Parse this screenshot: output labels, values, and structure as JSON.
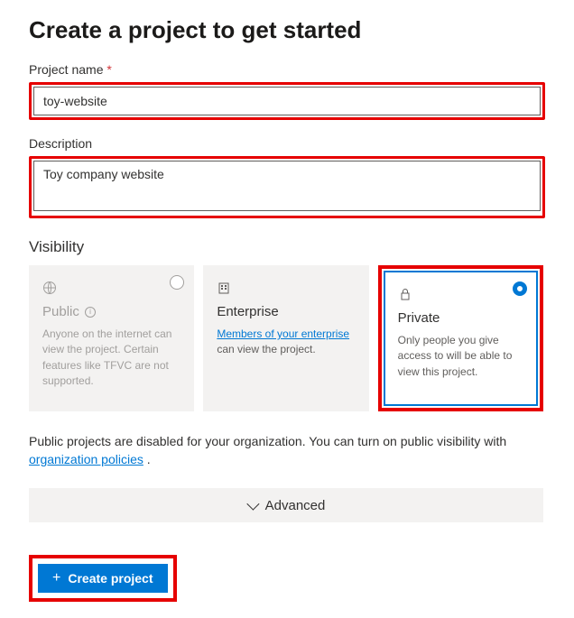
{
  "heading": "Create a project to get started",
  "projectName": {
    "label": "Project name",
    "requiredMark": "*",
    "value": "toy-website"
  },
  "description": {
    "label": "Description",
    "value": "Toy company website"
  },
  "visibility": {
    "label": "Visibility",
    "options": [
      {
        "key": "public",
        "title": "Public",
        "desc": "Anyone on the internet can view the project. Certain features like TFVC are not supported.",
        "disabled": true,
        "selected": false
      },
      {
        "key": "enterprise",
        "title": "Enterprise",
        "descPrefix": "Members of your enterprise",
        "descSuffix": " can view the project.",
        "disabled": false,
        "selected": false
      },
      {
        "key": "private",
        "title": "Private",
        "desc": "Only people you give access to will be able to view this project.",
        "disabled": false,
        "selected": true
      }
    ]
  },
  "footnote": {
    "text": "Public projects are disabled for your organization. You can turn on public visibility with ",
    "linkText": "organization policies",
    "suffix": " ."
  },
  "advanced": {
    "label": "Advanced"
  },
  "createButton": {
    "label": "Create project"
  }
}
